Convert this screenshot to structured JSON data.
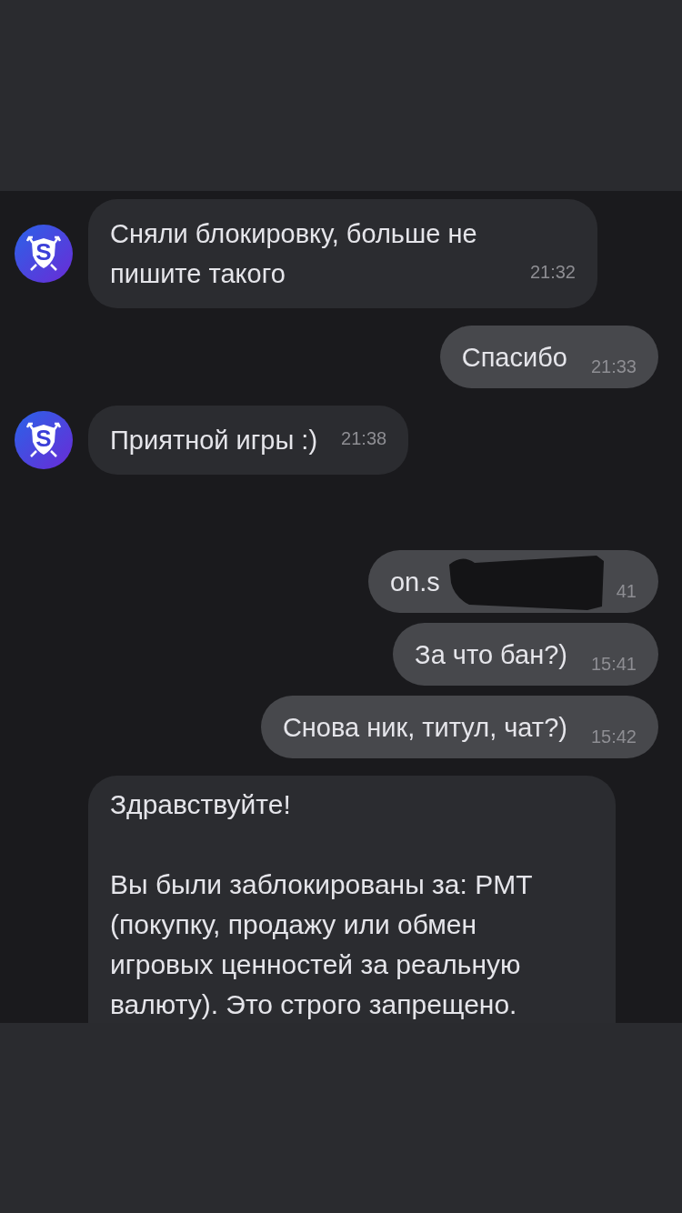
{
  "groups": [
    {
      "messages": [
        {
          "kind": "incoming",
          "avatar_letter": "S",
          "text": "Сняли блокировку, больше не пишите такого",
          "time": "21:32"
        },
        {
          "kind": "outgoing",
          "text": "Спасибо",
          "time": "21:33"
        },
        {
          "kind": "incoming",
          "avatar_letter": "S",
          "text": "Приятной игры :)",
          "time": "21:38"
        }
      ]
    },
    {
      "messages": [
        {
          "kind": "outgoing",
          "redacted": true,
          "text": "on.s",
          "time": "41"
        },
        {
          "kind": "outgoing",
          "text": "За что бан?)",
          "time": "15:41"
        },
        {
          "kind": "outgoing",
          "text": "Снова ник, титул, чат?)",
          "time": "15:42"
        },
        {
          "kind": "incoming_long",
          "paragraphs": [
            "Здравствуйте!",
            "Вы были заблокированы за: PMT (покупку, продажу или обмен игровых ценностей за реальную валюту). Это строго запрещено."
          ]
        }
      ]
    }
  ]
}
